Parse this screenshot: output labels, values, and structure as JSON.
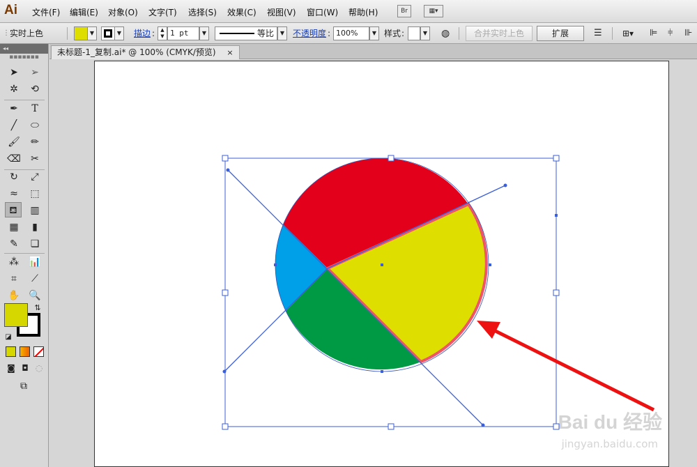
{
  "app": {
    "logo": "Ai"
  },
  "menu": [
    "文件(F)",
    "编辑(E)",
    "对象(O)",
    "文字(T)",
    "选择(S)",
    "效果(C)",
    "视图(V)",
    "窗口(W)",
    "帮助(H)"
  ],
  "menubar_icons": {
    "bridge": "Br",
    "arrange": "arrange-documents-icon"
  },
  "control": {
    "selection_label": "实时上色",
    "fill_color": "#dede00",
    "stroke_link": "描边",
    "stroke_weight": "1 pt",
    "stroke_profile": "等比",
    "opacity_link": "不透明度",
    "opacity_value": "100%",
    "style_label": "样式",
    "merge_button": "合并实时上色",
    "expand_button": "扩展"
  },
  "document": {
    "tab_title": "未标题-1_复制.ai* @ 100% (CMYK/预览)",
    "close": "×"
  },
  "artwork": {
    "colors": {
      "red": "#e2001a",
      "yellow": "#dedf00",
      "blue": "#00a0e9",
      "green": "#009a44",
      "selection": "#3a5fd9",
      "highlight": "#ee5566",
      "arrow": "#ee1111"
    }
  },
  "tools": {
    "fill_swatch": "#d7d700",
    "stroke_swatch": "#000000"
  },
  "watermark": {
    "logo": "Bai du 经验",
    "url": "jingyan.baidu.com"
  }
}
